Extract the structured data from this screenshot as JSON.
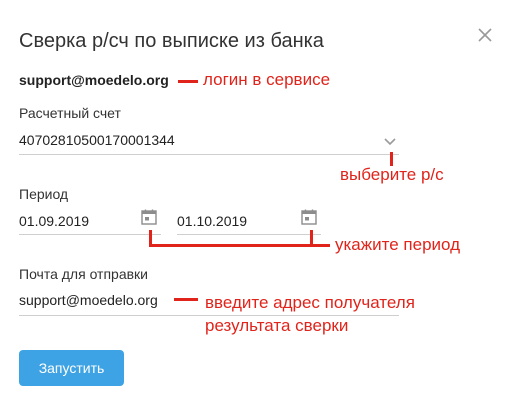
{
  "dialog": {
    "title": "Сверка р/сч по выписке из банка",
    "close_icon": "close-icon"
  },
  "login": {
    "value": "support@moedelo.org",
    "annotation": "логин в сервисе"
  },
  "account": {
    "label": "Расчетный счет",
    "value": "40702810500170001344",
    "dropdown_icon": "chevron-down-icon",
    "annotation": "выберите р/с"
  },
  "period": {
    "label": "Период",
    "from": "01.09.2019",
    "to": "01.10.2019",
    "calendar_icon": "calendar-icon",
    "annotation": "укажите период"
  },
  "email": {
    "label": "Почта для отправки",
    "value": "support@moedelo.org",
    "annotation_line1": "введите адрес получателя",
    "annotation_line2": "результата сверки"
  },
  "actions": {
    "run_label": "Запустить"
  },
  "colors": {
    "accent": "#3ea3e5",
    "annotation": "#e0241b"
  }
}
